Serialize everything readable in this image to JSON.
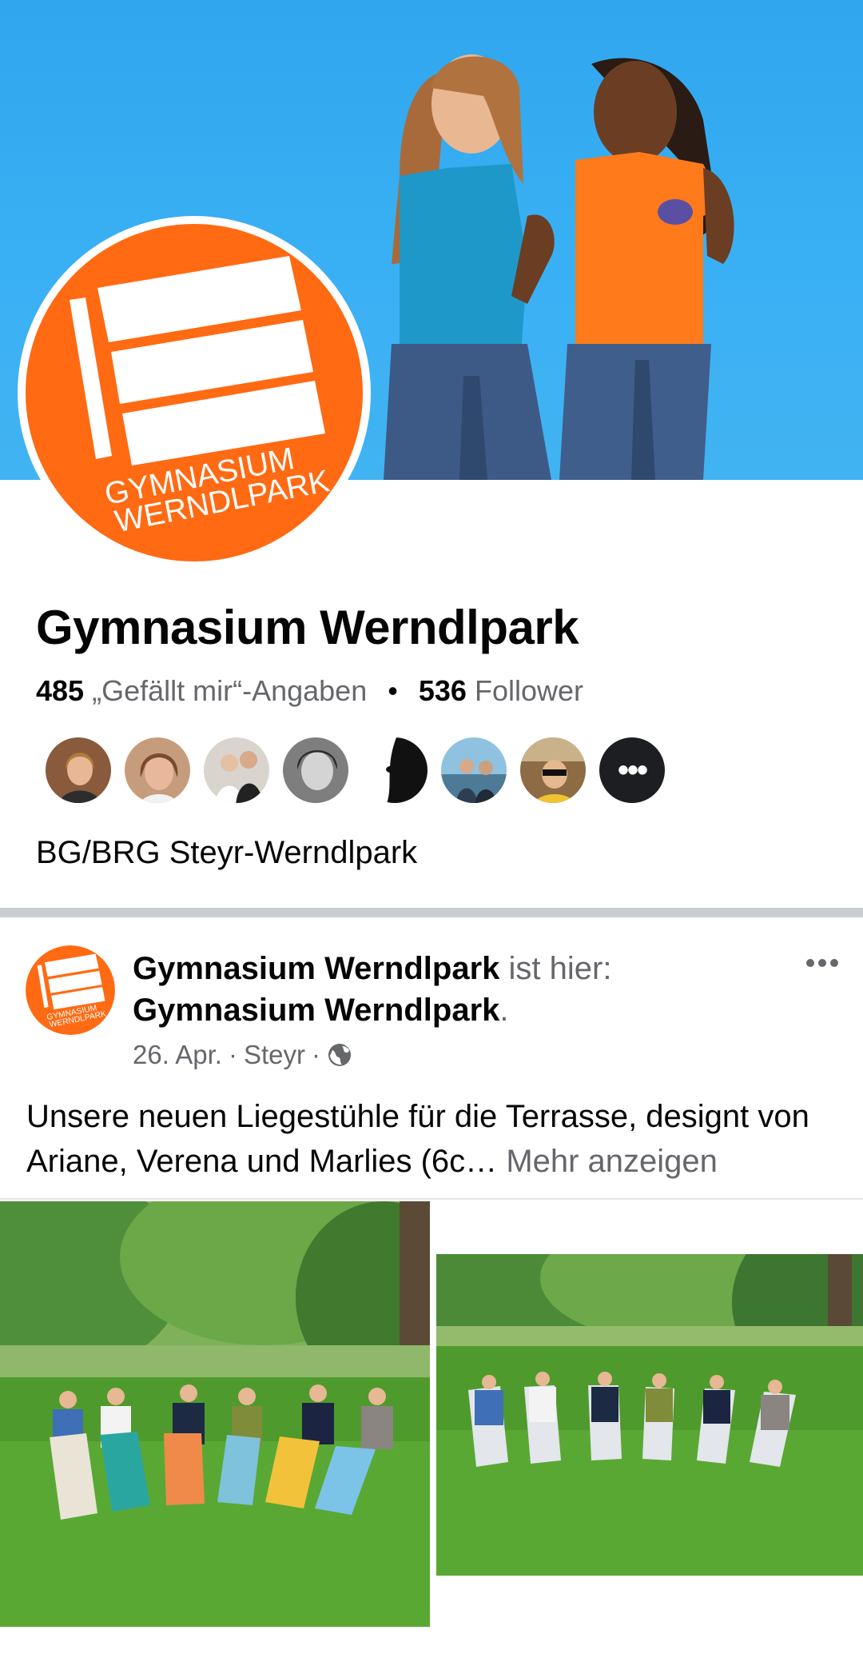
{
  "page": {
    "name": "Gymnasium Werndlpark",
    "likes_count": "485",
    "likes_label": "„Gefällt mir“-Angaben",
    "followers_count": "536",
    "followers_label": "Follower",
    "category": "BG/BRG Steyr-Werndlpark"
  },
  "logo": {
    "line1": "GYMNASIUM",
    "line2": "WERNDLPARK",
    "color": "#ff6a13"
  },
  "friends": [
    {
      "name": "friend-avatar-1",
      "bg": "#8a5a3c"
    },
    {
      "name": "friend-avatar-2",
      "bg": "#b07a55"
    },
    {
      "name": "friend-avatar-3",
      "bg": "#d9d4ce"
    },
    {
      "name": "friend-avatar-4",
      "bg": "#7e7e7e"
    },
    {
      "name": "friend-avatar-5",
      "bg": "#111111"
    },
    {
      "name": "friend-avatar-6",
      "bg": "#6fa7c9"
    },
    {
      "name": "friend-avatar-7",
      "bg": "#8c6b45"
    }
  ],
  "friends_more": "•••",
  "post": {
    "author": "Gymnasium Werndlpark",
    "checkin_text": "ist hier:",
    "location_name": "Gymnasium Werndlpark",
    "period": ".",
    "date": "26. Apr.",
    "separator": "·",
    "place": "Steyr",
    "body": "Unsere neuen Liegestühle für die Terrasse, designt von Ariane, Verena und Marlies (6c…",
    "see_more": "Mehr anzeigen"
  },
  "colors": {
    "cover_blue": "#3ab0f4",
    "brand_orange": "#ff6a13",
    "text_secondary": "#65676b"
  }
}
